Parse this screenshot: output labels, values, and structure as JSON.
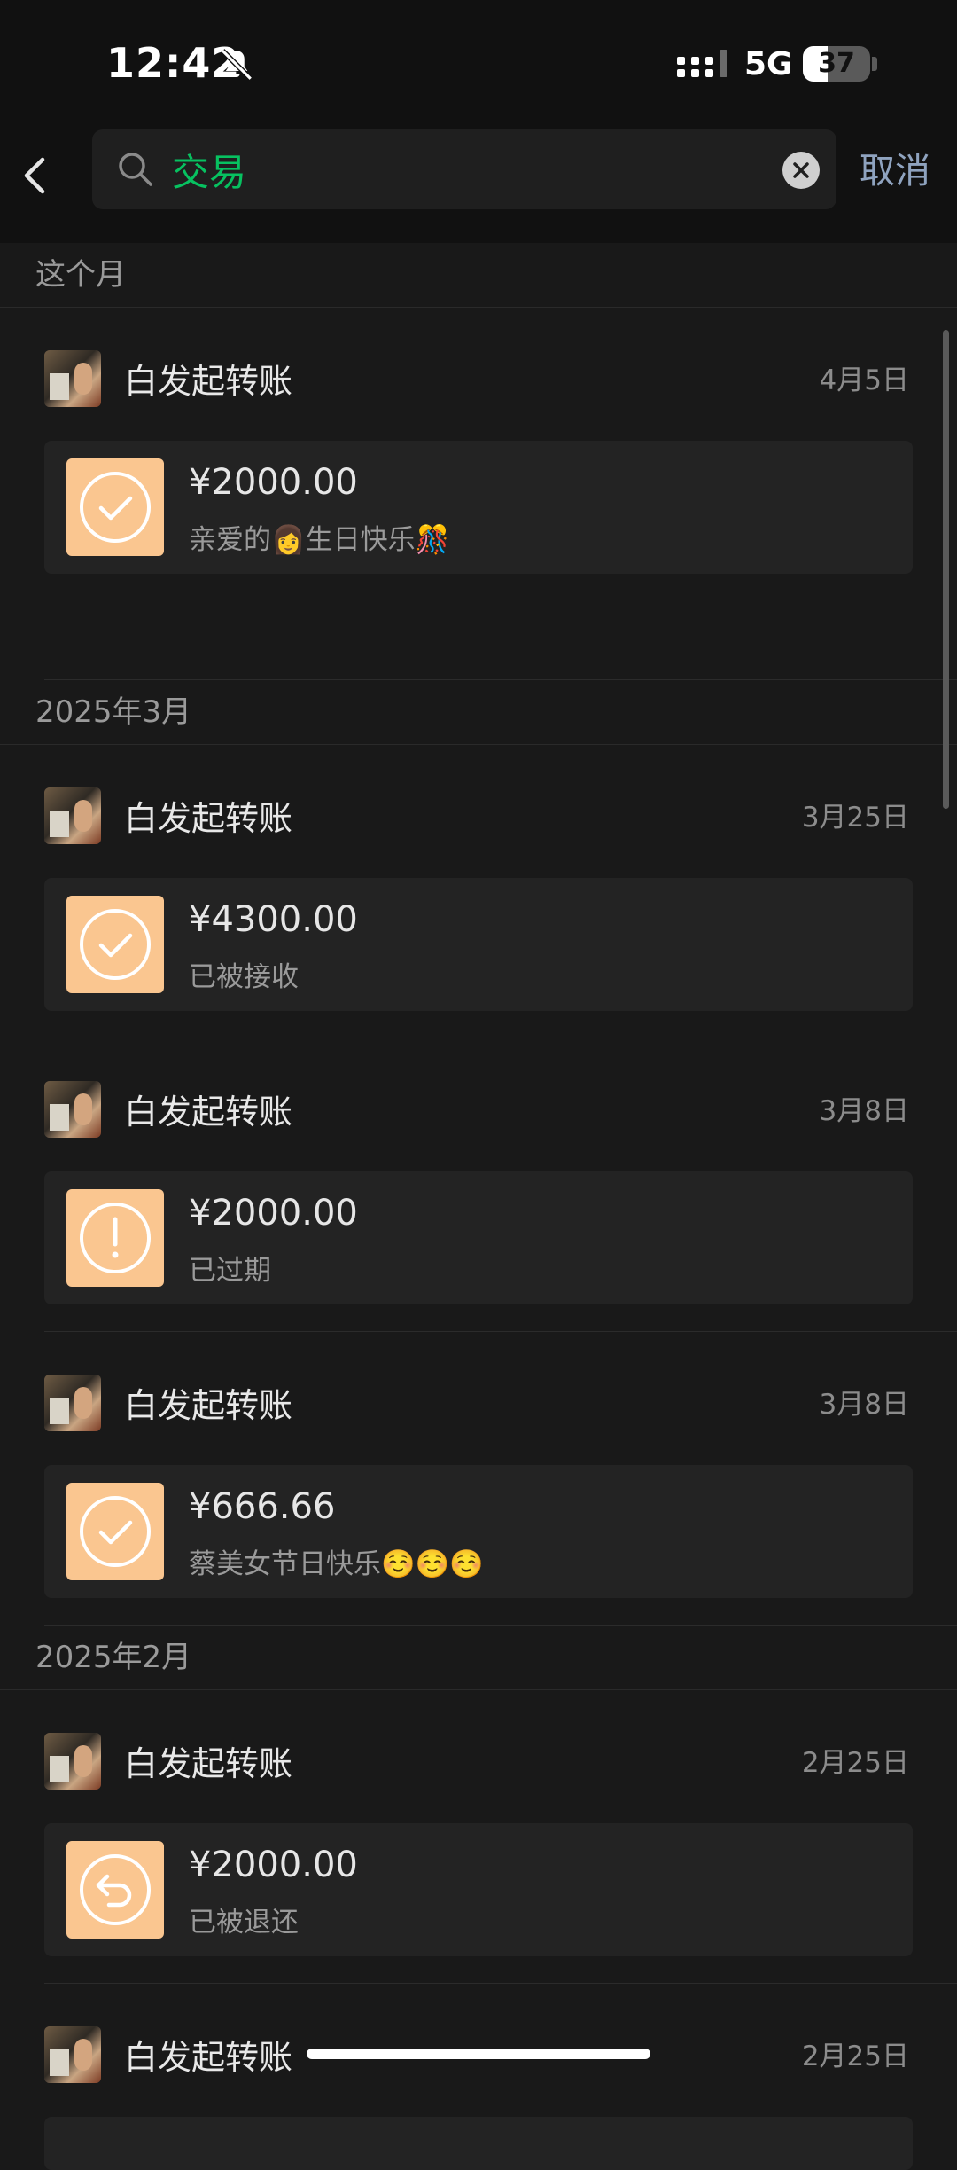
{
  "status_bar": {
    "time": "12:42",
    "network": "5G",
    "battery": "37",
    "battery_level": 0.37
  },
  "search": {
    "value": "交易",
    "placeholder": "",
    "cancel_label": "取消"
  },
  "sections": [
    {
      "month": "这个月",
      "records": [
        {
          "sender": "白发起转账",
          "date": "4月5日",
          "amount": "¥2000.00",
          "note": "亲爱的👩生日快乐🎊",
          "status_icon": "check-circle-icon"
        }
      ]
    },
    {
      "month": "2025年3月",
      "records": [
        {
          "sender": "白发起转账",
          "date": "3月25日",
          "amount": "¥4300.00",
          "note": "已被接收",
          "status_icon": "check-circle-icon"
        },
        {
          "sender": "白发起转账",
          "date": "3月8日",
          "amount": "¥2000.00",
          "note": "已过期",
          "status_icon": "exclamation-circle-icon"
        },
        {
          "sender": "白发起转账",
          "date": "3月8日",
          "amount": "¥666.66",
          "note": "蔡美女节日快乐☺️☺️☺️",
          "status_icon": "check-circle-icon"
        }
      ]
    },
    {
      "month": "2025年2月",
      "records": [
        {
          "sender": "白发起转账",
          "date": "2月25日",
          "amount": "¥2000.00",
          "note": "已被退还",
          "status_icon": "return-circle-icon"
        },
        {
          "sender": "白发起转账",
          "date": "2月25日",
          "amount": "",
          "note": "",
          "status_icon": ""
        }
      ]
    }
  ],
  "colors": {
    "accent_green": "#07c160",
    "card_icon_bg": "#fac690",
    "link_blue": "#8fa3bf"
  }
}
